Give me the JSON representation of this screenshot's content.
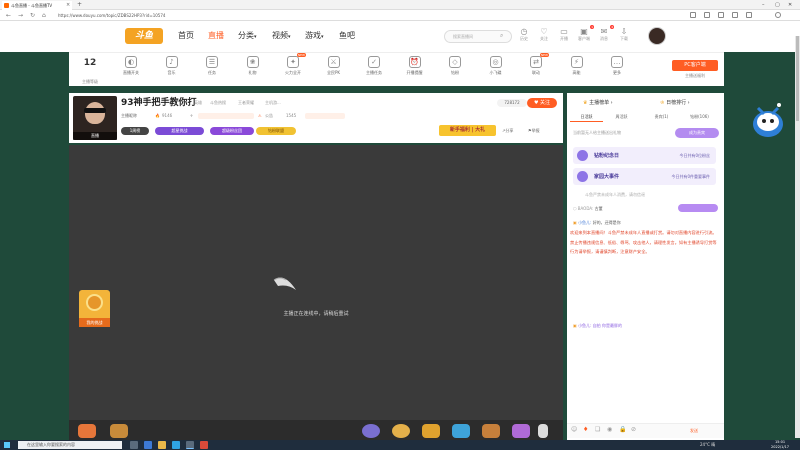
{
  "browser": {
    "tab_title": "斗鱼直播 - 斗鱼直播TV",
    "url": "https://www.douyu.com/topic/ZDBS22HP3?rid=10574",
    "tab_close": "×",
    "new_tab": "+"
  },
  "header": {
    "logo": "斗鱼",
    "nav": [
      "首页",
      "直播",
      "分类",
      "视频",
      "游戏",
      "鱼吧"
    ],
    "search_placeholder": "搜索直播间",
    "icons": [
      {
        "label": "历史",
        "glyph": "◷"
      },
      {
        "label": "关注",
        "glyph": "♡"
      },
      {
        "label": "开播",
        "glyph": "▭"
      },
      {
        "label": "客户端",
        "glyph": "▣",
        "badge": "1"
      },
      {
        "label": "消息",
        "glyph": "✉",
        "badge": "4"
      },
      {
        "label": "下载",
        "glyph": "⇩"
      }
    ]
  },
  "subnav": {
    "level": "12",
    "level_label": "主播等级",
    "items": [
      {
        "label": "直播开关",
        "glyph": "◐"
      },
      {
        "label": "音乐",
        "glyph": "♪"
      },
      {
        "label": "任务",
        "glyph": "☰"
      },
      {
        "label": "礼物",
        "glyph": "❀"
      },
      {
        "label": "火力全开",
        "glyph": "✦",
        "tag": "NEW"
      },
      {
        "label": "全民PK",
        "glyph": "⚔"
      },
      {
        "label": "主播任务",
        "glyph": "✓"
      },
      {
        "label": "开播提醒",
        "glyph": "⏰"
      },
      {
        "label": "钻粉",
        "glyph": "◇"
      },
      {
        "label": "小飞碟",
        "glyph": "◎"
      },
      {
        "label": "联动",
        "glyph": "⇄",
        "tag": "NEW"
      },
      {
        "label": "高能",
        "glyph": "⚡"
      },
      {
        "label": "更多",
        "glyph": "…"
      }
    ],
    "pc_button": "PC客户端",
    "pc_sub": "主播送福利"
  },
  "room": {
    "title": "93神手把手教你打",
    "category": "英雄",
    "tags": [
      "斗鱼热搜",
      "王者荣耀",
      "主机游..."
    ],
    "viewers": "728172",
    "follow": "关注",
    "avatar_label": "直播",
    "owner": "主播昵称",
    "fans": "9146",
    "notice": "公告",
    "rank": "1545",
    "pills": [
      "1周榜",
      "超星挑战",
      "超级粉丝团",
      "钻粉联盟"
    ],
    "newbie": "新手福利 | 大礼",
    "share": "分享",
    "report": "举报"
  },
  "video": {
    "offline_text": "主播正在连线中，请稍后重试",
    "gift_tile_label": "我的挑战"
  },
  "right_panel": {
    "rank_title": "主播榜单",
    "rank_title2": "日榜排行",
    "tabs": [
      "日活跃",
      "周活跃",
      "贵宾(1)",
      "钻粉(106)"
    ],
    "empty_text": "当前暂无人给主播送出礼物",
    "shout_btn": "成为贵宾",
    "events": [
      {
        "title": "钻粉纪念日",
        "desc": "今日共有0位粉丝"
      },
      {
        "title": "家园大事件",
        "desc": "今日共有0件重要事件"
      }
    ],
    "chat1": "斗鱼严禁未成年人消费，请勿信谣",
    "chat2_name": "BAODA",
    "chat2_text": "古董",
    "chat3_name": "小鱼儿",
    "chat3_text": "好的，还得是你",
    "system_msg": "欢迎来到本直播间！斗鱼严禁未成年人直播或打赏。请勿对直播内容进行引流。禁止传播违规信息、低俗、辱骂、攻击他人，请理性发言。如有主播诱导打赏等行为请举报，请谨慎判断，注意财产安全。",
    "chat4_name": "小鱼儿",
    "chat4_text": "自拍 你是最胖的",
    "send_btn": "发送"
  },
  "taskbar": {
    "search": "在这里输入你要搜索的内容",
    "time": "15:01",
    "date": "2022/1/17",
    "tray": "24°C 晴"
  },
  "colors": {
    "accent": "#ff5d23",
    "panel_purple": "#8d74e6",
    "video_bg": "#3a3a3a"
  }
}
